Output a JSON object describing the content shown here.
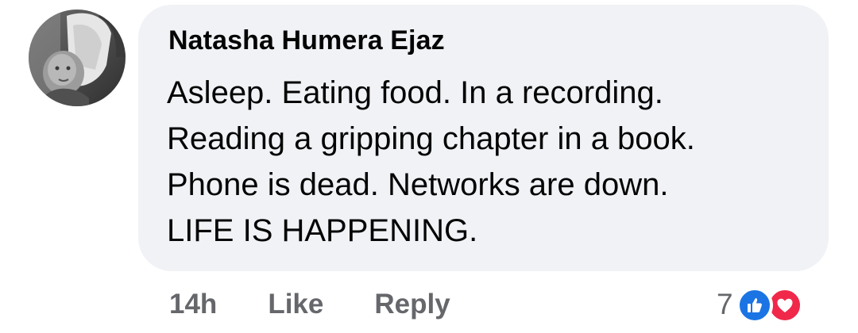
{
  "comment": {
    "author": "Natasha Humera Ejaz",
    "lines": [
      "Asleep. Eating food. In a recording.",
      "Reading a gripping chapter in a book.",
      "Phone is dead. Networks are down.",
      "LIFE IS HAPPENING."
    ],
    "timestamp": "14h",
    "like_label": "Like",
    "reply_label": "Reply",
    "reaction_count": "7",
    "reaction_icons": [
      "like-icon",
      "love-icon"
    ]
  },
  "colors": {
    "bubble_bg": "#f0f2f5",
    "text": "#050505",
    "secondary_text": "#65676b",
    "like_blue": "#1b74e4",
    "love_red": "#f02849"
  }
}
